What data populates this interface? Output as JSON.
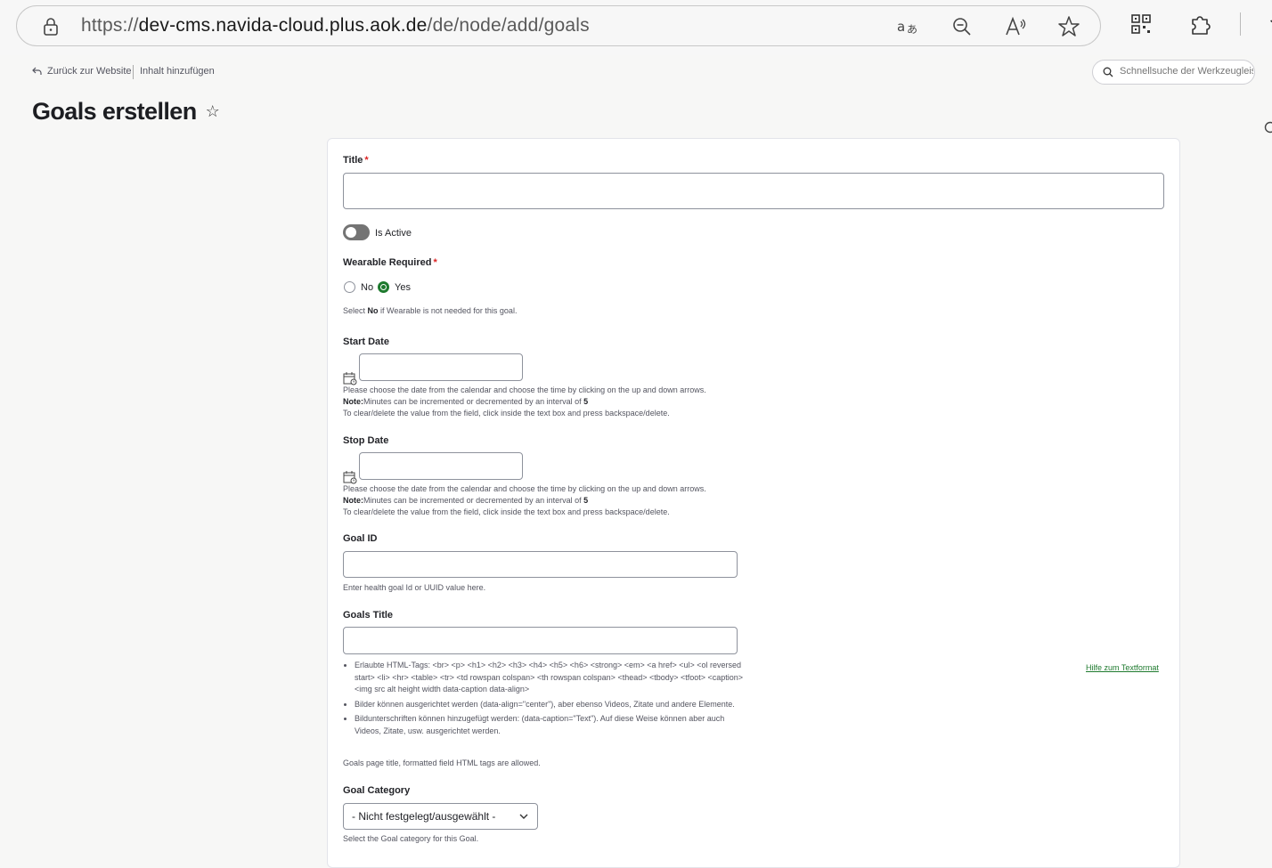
{
  "browser": {
    "url_prefix": "https://",
    "url_host": "dev-cms.navida-cloud.plus.aok.de",
    "url_path": "/de/node/add/goals"
  },
  "toolbar": {
    "back_label": "Zurück zur Website",
    "add_content_label": "Inhalt hinzufügen",
    "quicksearch_placeholder": "Schnellsuche der Werkzeugleiste"
  },
  "page": {
    "title": "Goals erstellen",
    "star": "☆"
  },
  "form": {
    "title_label": "Title",
    "required_mark": "*",
    "is_active_label": "Is Active",
    "is_active": false,
    "wearable_label": "Wearable Required",
    "wearable_options": [
      "No",
      "Yes"
    ],
    "wearable_selected": "Yes",
    "wearable_desc_pre": "Select ",
    "wearable_desc_bold": "No",
    "wearable_desc_post": " if Wearable is not needed for this goal.",
    "start_date_label": "Start Date",
    "stop_date_label": "Stop Date",
    "date_help_1": "Please choose the date from the calendar and choose the time by clicking on the up and down arrows.",
    "date_help_note_bold": "Note:",
    "date_help_note": "Minutes can be incremented or decremented by an interval of ",
    "date_help_interval": "5",
    "date_help_3": "To clear/delete the value from the field, click inside the text box and press backspace/delete.",
    "goal_id_label": "Goal ID",
    "goal_id_desc": "Enter health goal Id or UUID value here.",
    "goals_title_label": "Goals Title",
    "format_tips": [
      "Erlaubte HTML-Tags: <br> <p> <h1> <h2> <h3> <h4> <h5> <h6> <strong> <em> <a href> <ul> <ol reversed start> <li> <hr> <table> <tr> <td rowspan colspan> <th rowspan colspan> <thead> <tbody> <tfoot> <caption> <img src alt height width data-caption data-align>",
      "Bilder können ausgerichtet werden (data-align=\"center\"), aber ebenso Videos, Zitate und andere Elemente.",
      "Bildunterschriften können hinzugefügt werden: (data-caption=\"Text\"). Auf diese Weise können aber auch Videos, Zitate, usw. ausgerichtet werden."
    ],
    "format_help_link": "Hilfe zum Textformat",
    "goals_title_desc": "Goals page title, formatted field HTML tags are allowed.",
    "goal_category_label": "Goal Category",
    "goal_category_value": "- Nicht festgelegt/ausgewählt -",
    "goal_category_desc": "Select the Goal category for this Goal."
  }
}
